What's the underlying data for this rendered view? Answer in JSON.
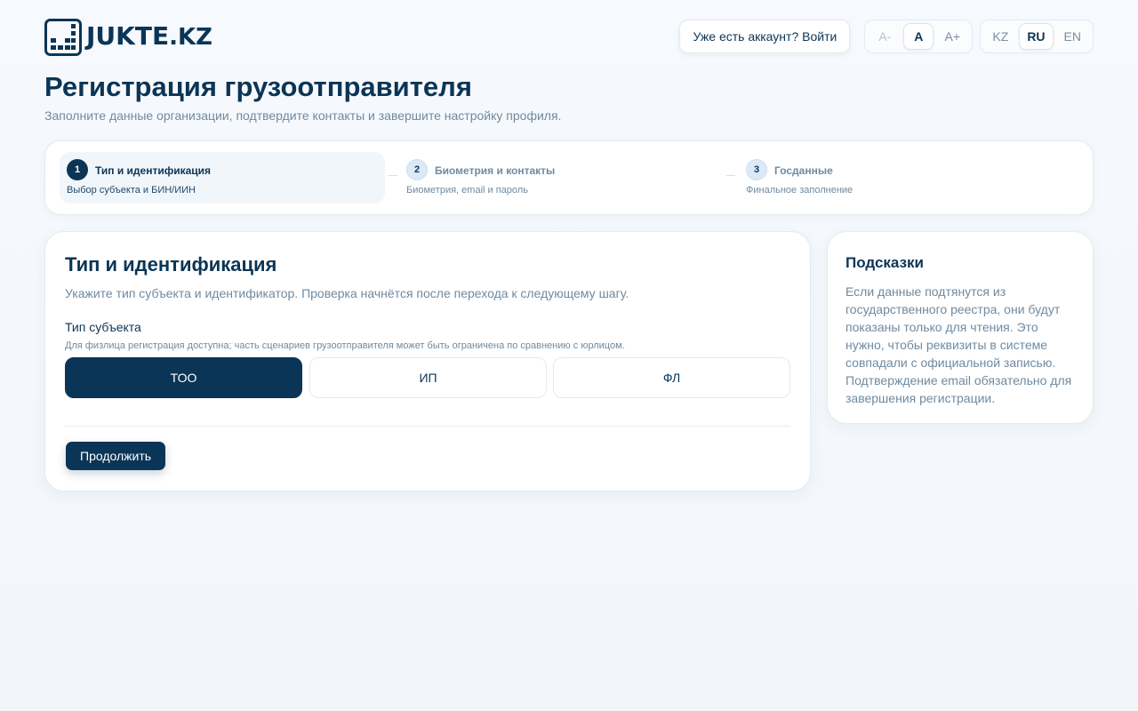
{
  "brand": {
    "name": "JUKTE",
    "domain": ".KZ",
    "color": "#0b3556"
  },
  "header": {
    "login_link": "Уже есть аккаунт? Войти",
    "font_size": [
      "A-",
      "A",
      "A+"
    ],
    "languages": [
      "KZ",
      "RU",
      "EN"
    ],
    "active_language": "RU"
  },
  "page": {
    "title": "Регистрация грузоотправителя",
    "subtitle": "Заполните данные организации, подтвердите контакты и завершите настройку профиля."
  },
  "steps": [
    {
      "num": "1",
      "title": "Тип и идентификация",
      "desc": "Выбор субъекта и БИН/ИИН",
      "active": true
    },
    {
      "num": "2",
      "title": "Биометрия и контакты",
      "desc": "Биометрия, email и пароль",
      "active": false
    },
    {
      "num": "3",
      "title": "Госданные",
      "desc": "Финальное заполнение",
      "active": false
    }
  ],
  "form": {
    "title": "Тип и идентификация",
    "lead": "Укажите тип субъекта и идентификатор. Проверка начнётся после перехода к следующему шагу.",
    "subject_label": "Тип субъекта",
    "subject_hint": "Для физлица регистрация доступна; часть сценариев грузоотправителя может быть ограничена по сравнению с юрлицом.",
    "options": [
      "ТОО",
      "ИП",
      "ФЛ"
    ],
    "selected": "ТОО",
    "continue_label": "Продолжить"
  },
  "tips": {
    "title": "Подсказки",
    "text": "Если данные подтянутся из государственного реестра, они будут показаны только для чтения. Это нужно, чтобы реквизиты в системе совпадали с официальной записью. Подтверждение email обязательно для завершения регистрации."
  }
}
